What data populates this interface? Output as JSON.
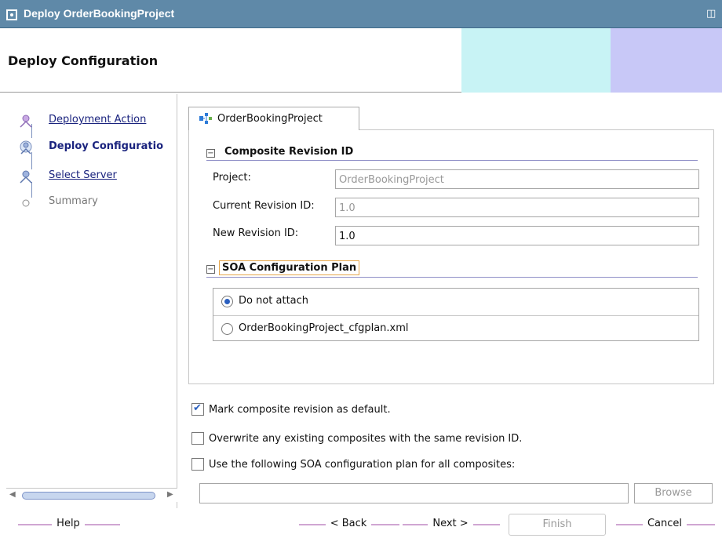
{
  "window": {
    "title": "Deploy OrderBookingProject",
    "window_icon": "window-icon",
    "maximize_icon": "maximize-icon"
  },
  "header": {
    "title": "Deploy Configuration",
    "accent_cyan": "#c8f3f5",
    "accent_violet": "#c8c8f7"
  },
  "nav": {
    "items": [
      {
        "label": "Deployment Action",
        "state": "visited",
        "icon": "step-person-icon"
      },
      {
        "label": "Deploy Configuratio",
        "state": "active",
        "icon": "step-active-icon"
      },
      {
        "label": "Select Server",
        "state": "visited",
        "icon": "step-person-icon"
      },
      {
        "label": "Summary",
        "state": "pending",
        "icon": "step-circle-icon"
      }
    ]
  },
  "tab": {
    "label": "OrderBookingProject",
    "icon": "composite-project-icon"
  },
  "composite_revision": {
    "title": "Composite Revision ID",
    "project_label": "Project:",
    "project_value": "OrderBookingProject",
    "current_label": "Current Revision ID:",
    "current_value": "1.0",
    "new_label": "New Revision ID:",
    "new_value": "1.0"
  },
  "soa_plan": {
    "title": "SOA Configuration Plan",
    "options": [
      {
        "label": "Do not attach",
        "selected": true
      },
      {
        "label": "OrderBookingProject_cfgplan.xml",
        "selected": false
      }
    ]
  },
  "options": {
    "mark_default": {
      "label": "Mark composite revision as default.",
      "checked": true
    },
    "overwrite": {
      "label": "Overwrite any existing composites with the same revision ID.",
      "checked": false
    },
    "use_plan": {
      "label": "Use the following SOA configuration plan for all composites:",
      "checked": false
    }
  },
  "plan_path": {
    "value": ""
  },
  "buttons": {
    "browse": "Browse",
    "help": "Help",
    "back": "< Back",
    "next": "Next >",
    "finish": "Finish",
    "cancel": "Cancel"
  },
  "colors": {
    "titlebar": "#5f89a8",
    "link": "#1a237e",
    "button_bar": "#d0a6d3"
  }
}
